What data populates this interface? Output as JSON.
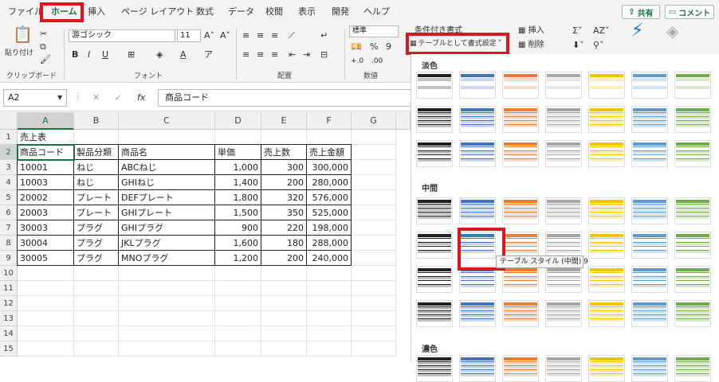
{
  "menu": {
    "tabs": [
      "ファイル",
      "ホーム",
      "挿入",
      "ページ レイアウト",
      "数式",
      "データ",
      "校閲",
      "表示",
      "開発",
      "ヘルプ"
    ],
    "share": "共有",
    "comment": "コメント"
  },
  "ribbon": {
    "paste": "貼り付け",
    "font_name": "游ゴシック",
    "font_size": "11",
    "number_format": "標準",
    "conditional": "条件付き書式",
    "format_table": "テーブルとして書式設定",
    "insert": "挿入",
    "delete": "削除",
    "groups": {
      "clipboard": "クリップボード",
      "font": "フォント",
      "alignment": "配置",
      "number": "数値"
    }
  },
  "formula": {
    "cell_ref": "A2",
    "fx": "fx",
    "value": "商品コード"
  },
  "columns": [
    "A",
    "B",
    "C",
    "D",
    "E",
    "F",
    "G"
  ],
  "rows": [
    "1",
    "2",
    "3",
    "4",
    "5",
    "6",
    "7",
    "8",
    "9",
    "10",
    "11",
    "12",
    "13",
    "14",
    "15"
  ],
  "sheet": {
    "title": "売上表",
    "headers": [
      "商品コード",
      "製品分類",
      "商品名",
      "単価",
      "売上数",
      "売上金額"
    ],
    "data": [
      [
        "10001",
        "ねじ",
        "ABCねじ",
        "1,000",
        "300",
        "300,000"
      ],
      [
        "10003",
        "ねじ",
        "GHIねじ",
        "1,400",
        "200",
        "280,000"
      ],
      [
        "20002",
        "プレート",
        "DEFプレート",
        "1,800",
        "320",
        "576,000"
      ],
      [
        "20003",
        "プレート",
        "GHIプレート",
        "1,500",
        "350",
        "525,000"
      ],
      [
        "30003",
        "プラグ",
        "GHIプラグ",
        "900",
        "220",
        "198,000"
      ],
      [
        "30004",
        "プラグ",
        "JKLプラグ",
        "1,600",
        "180",
        "288,000"
      ],
      [
        "30005",
        "プラグ",
        "MNOプラグ",
        "1,200",
        "200",
        "240,000"
      ]
    ]
  },
  "gallery": {
    "light": "淡色",
    "medium": "中間",
    "dark": "濃色",
    "tooltip": "テーブル スタイル (中間) 9"
  },
  "colors": {
    "accent": "#1f6e43",
    "highlight": "#e0141e"
  }
}
